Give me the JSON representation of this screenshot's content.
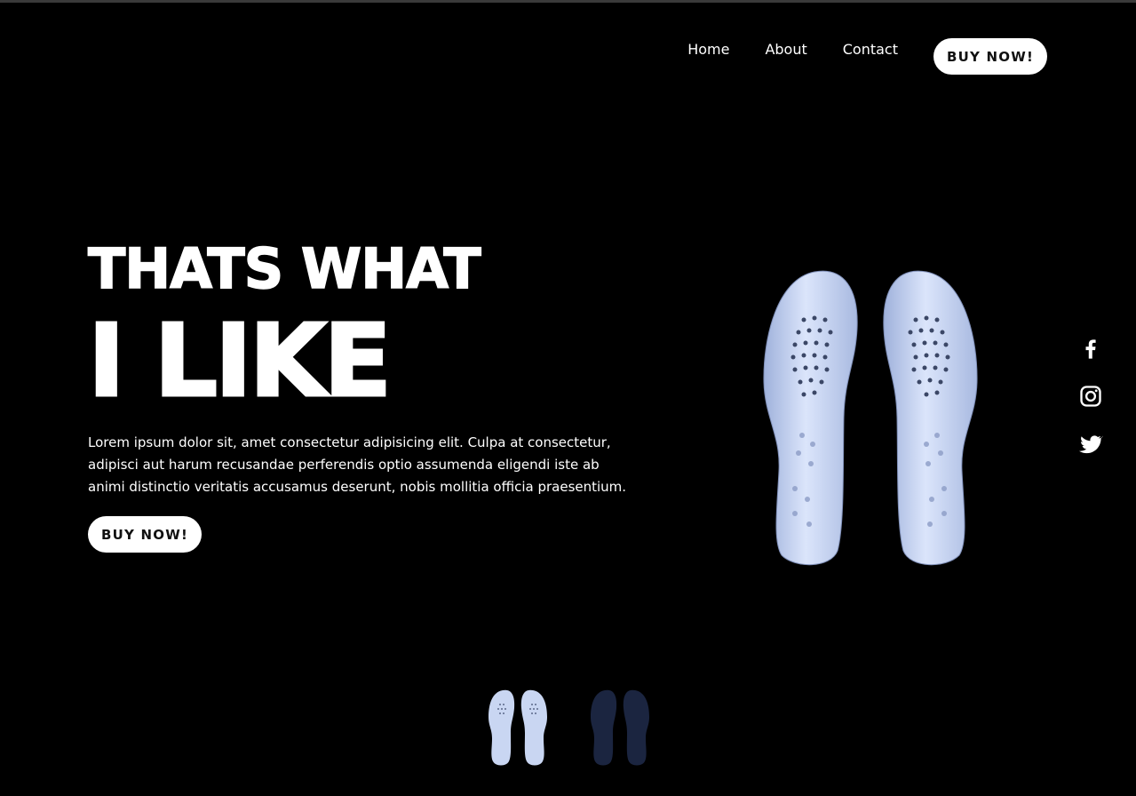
{
  "nav": {
    "links": [
      "Home",
      "About",
      "Contact"
    ],
    "buy_label": "BUY NOW!"
  },
  "hero": {
    "title_line1": "THATS WHAT",
    "title_line2": "I LIKE",
    "description": "Lorem ipsum dolor sit, amet consectetur adipisicing elit. Culpa at consectetur, adipisci aut harum recusandae perferendis optio assumenda eligendi iste ab animi distinctio veritatis accusamus deserunt, nobis mollitia officia praesentium.",
    "buy_label": "BUY NOW!"
  },
  "product": {
    "image": "white-insoles"
  },
  "social": [
    "facebook-icon",
    "instagram-icon",
    "twitter-icon"
  ],
  "thumbnails": [
    "white-insoles-thumbnail",
    "navy-insoles-thumbnail"
  ],
  "colors": {
    "background": "#000000",
    "text": "#ffffff",
    "button_bg": "#ffffff",
    "button_text": "#111111",
    "insole_white": "#c9d6f2",
    "insole_navy": "#1b2540"
  }
}
